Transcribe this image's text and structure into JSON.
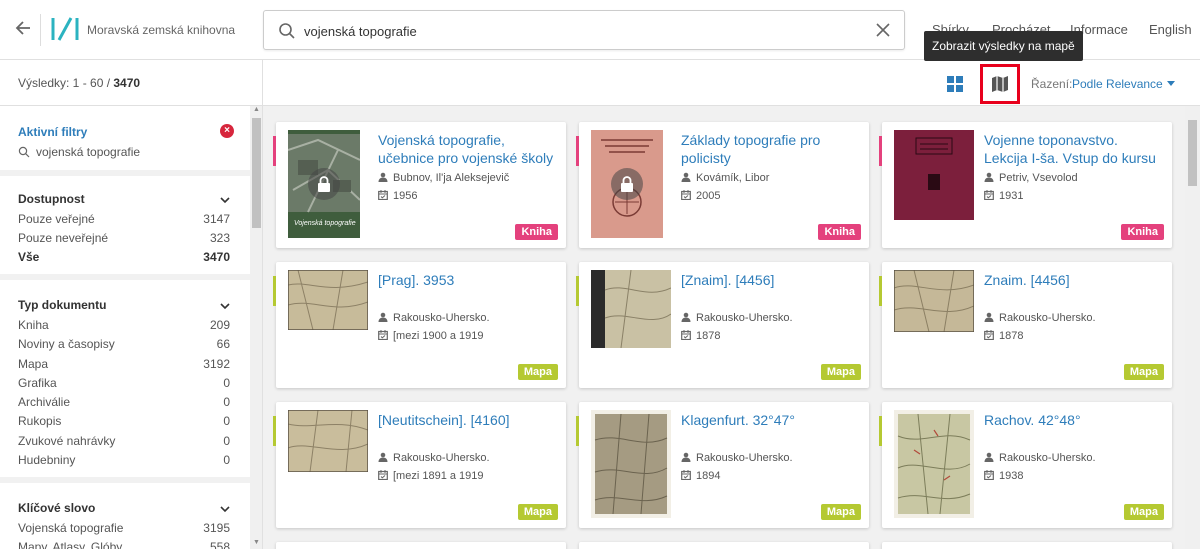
{
  "header": {
    "logo_text": "Moravská zemská knihovna",
    "search_value": "vojenská topografie",
    "nav": [
      "Sbírky",
      "Procházet",
      "Informace",
      "English"
    ],
    "tooltip": "Zobrazit výsledky na mapě"
  },
  "results": {
    "prefix": "Výsledky: 1 - 60 / ",
    "total": "3470"
  },
  "toolbar": {
    "sort_label": "Řazení:",
    "sort_value": "Podle Relevance"
  },
  "sidebar": {
    "active_title": "Aktivní filtry",
    "active_query": "vojenská topografie",
    "facets": [
      {
        "title": "Dostupnost",
        "items": [
          {
            "label": "Pouze veřejné",
            "count": "3147"
          },
          {
            "label": "Pouze neveřejné",
            "count": "323"
          },
          {
            "label": "Vše",
            "count": "3470"
          }
        ]
      },
      {
        "title": "Typ dokumentu",
        "items": [
          {
            "label": "Kniha",
            "count": "209"
          },
          {
            "label": "Noviny a časopisy",
            "count": "66"
          },
          {
            "label": "Mapa",
            "count": "3192"
          },
          {
            "label": "Grafika",
            "count": "0"
          },
          {
            "label": "Archiválie",
            "count": "0"
          },
          {
            "label": "Rukopis",
            "count": "0"
          },
          {
            "label": "Zvukové nahrávky",
            "count": "0"
          },
          {
            "label": "Hudebniny",
            "count": "0"
          }
        ]
      },
      {
        "title": "Klíčové slovo",
        "items": [
          {
            "label": "Vojenská topografie",
            "count": "3195"
          },
          {
            "label": "Mapy. Atlasy. Glóby",
            "count": "558"
          }
        ]
      }
    ]
  },
  "cards": [
    {
      "title": "Vojenská topografie, učebnice pro vojenské školy",
      "author": "Bubnov, Il'ja Aleksejevič",
      "date": "1956",
      "badge": "Kniha",
      "thumb_caption": "Vojenská topografie"
    },
    {
      "title": "Základy topografie pro policisty",
      "author": "Kovámík, Libor",
      "date": "2005",
      "badge": "Kniha"
    },
    {
      "title": "Vojenne toponavstvo. Lekcija I-ša. Vstup do kursu",
      "author": "Petriv, Vsevolod",
      "date": "1931",
      "badge": "Kniha"
    },
    {
      "title": "[Prag]. 3953",
      "author": "Rakousko-Uhersko.",
      "date": "[mezi 1900 a 1919",
      "badge": "Mapa"
    },
    {
      "title": "[Znaim]. [4456]",
      "author": "Rakousko-Uhersko.",
      "date": "1878",
      "badge": "Mapa"
    },
    {
      "title": "Znaim. [4456]",
      "author": "Rakousko-Uhersko.",
      "date": "1878",
      "badge": "Mapa"
    },
    {
      "title": "[Neutitschein]. [4160]",
      "author": "Rakousko-Uhersko.",
      "date": "[mezi 1891 a 1919",
      "badge": "Mapa"
    },
    {
      "title": "Klagenfurt. 32°47°",
      "author": "Rakousko-Uhersko.",
      "date": "1894",
      "badge": "Mapa"
    },
    {
      "title": "Rachov. 42°48°",
      "author": "Rakousko-Uhersko.",
      "date": "1938",
      "badge": "Mapa"
    }
  ],
  "colors": {
    "accent": "#2e7dba",
    "kniha": "#e4417d",
    "mapa": "#b5c932",
    "highlight": "#e8001c"
  }
}
